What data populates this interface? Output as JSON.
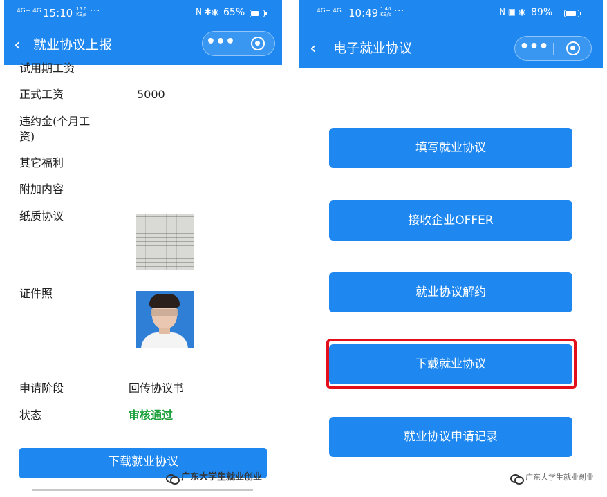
{
  "left": {
    "status": {
      "signal": "4G+ 4G",
      "time": "15:10",
      "speed_top": "15.0",
      "speed_bottom": "KB/s",
      "dots": "···",
      "icons": "N ✱",
      "battery": "65%",
      "battery_level": 0.65
    },
    "nav": {
      "title": "就业协议上报",
      "back_icon": "‹"
    },
    "fields": [
      {
        "label": "试用期工资",
        "value": ""
      },
      {
        "label": "正式工资",
        "value": "5000"
      },
      {
        "label": "违约金(个月工",
        "label2": "资)",
        "value": ""
      },
      {
        "label": "其它福利",
        "value": ""
      },
      {
        "label": "附加内容",
        "value": ""
      },
      {
        "label": "纸质协议",
        "value": ""
      },
      {
        "label": "证件照",
        "value": ""
      },
      {
        "label": "申请阶段",
        "value": "回传协议书"
      },
      {
        "label": "状态",
        "value": "审核通过"
      }
    ],
    "download_button": "下载就业协议",
    "watermark": "广东大学生就业创业",
    "status_color": "#1ba03a"
  },
  "right": {
    "status": {
      "signal": "4G+ 4G",
      "time": "10:49",
      "speed_top": "1.40",
      "speed_bottom": "KB/s",
      "dots": "···",
      "icons": "N ▣",
      "battery": "89%",
      "battery_level": 0.89
    },
    "nav": {
      "title": "电子就业协议",
      "back_icon": "‹"
    },
    "buttons": [
      "填写就业协议",
      "接收企业OFFER",
      "就业协议解约",
      "下载就业协议",
      "就业协议申请记录"
    ],
    "watermark": "广东大学生就业创业"
  },
  "colors": {
    "brand_blue": "#1e88f0",
    "highlight_red": "#e3101c"
  }
}
